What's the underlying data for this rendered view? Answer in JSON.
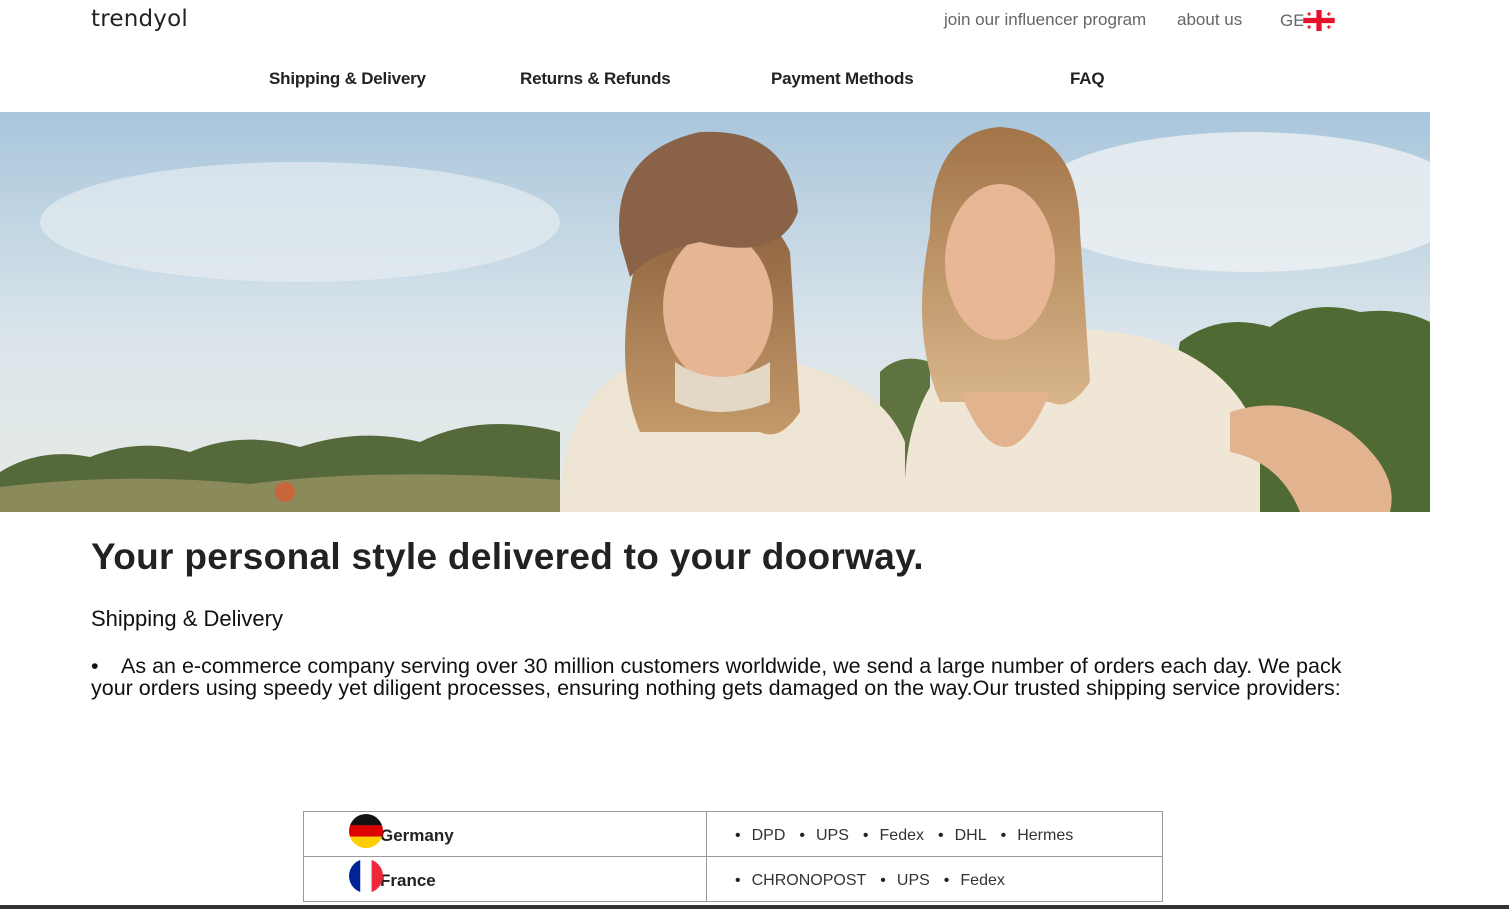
{
  "header": {
    "logo": "trendyol",
    "influencer_link": "join our influencer program",
    "about_link": "about us",
    "language_code": "GE",
    "language_flag_icon": "georgia-flag-icon"
  },
  "nav": {
    "items": [
      {
        "label": "Shipping & Delivery"
      },
      {
        "label": "Returns & Refunds"
      },
      {
        "label": "Payment Methods"
      },
      {
        "label": "FAQ"
      }
    ]
  },
  "hero": {
    "image": "two-women-knit-sweaters-photo"
  },
  "main": {
    "headline": "Your personal style delivered to your doorway.",
    "section_title": "Shipping & Delivery",
    "bullet_text": "As an e-commerce company serving over 30 million customers worldwide, we send a large number of orders each day. We pack your orders using speedy yet diligent processes, ensuring nothing gets damaged on the way.Our trusted shipping service providers:"
  },
  "shipping_table": {
    "rows": [
      {
        "country": "Germany",
        "flag_icon": "germany-flag-icon",
        "carriers": [
          "DPD",
          "UPS",
          "Fedex",
          "DHL",
          "Hermes"
        ]
      },
      {
        "country": "France",
        "flag_icon": "france-flag-icon",
        "carriers": [
          "CHRONOPOST",
          "UPS",
          "Fedex"
        ]
      }
    ]
  },
  "colors": {
    "text_dark": "#222222",
    "text_muted": "#666666",
    "table_border": "#999999",
    "ge_flag_red": "#e8112d"
  }
}
